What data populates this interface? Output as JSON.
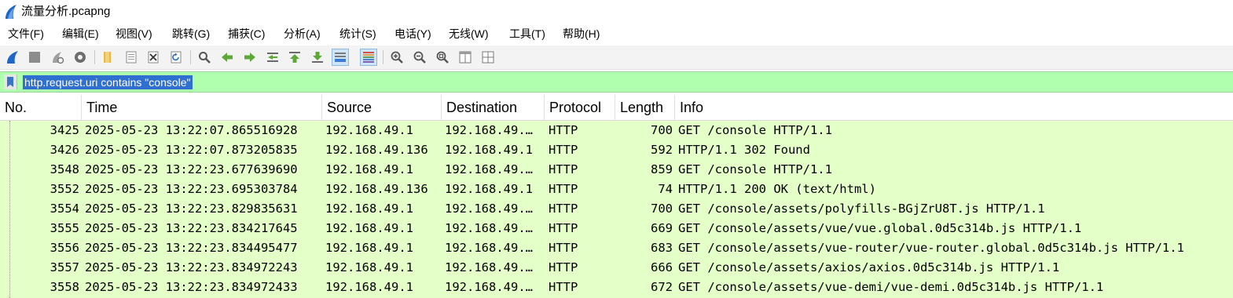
{
  "window": {
    "title": "流量分析.pcapng",
    "icon": "wireshark-fin-icon"
  },
  "menu": [
    "文件(F)",
    "编辑(E)",
    "视图(V)",
    "跳转(G)",
    "捕获(C)",
    "分析(A)",
    "统计(S)",
    "电话(Y)",
    "无线(W)",
    "工具(T)",
    "帮助(H)"
  ],
  "toolbar_icons": [
    "start-capture-icon",
    "stop-capture-icon",
    "restart-capture-icon",
    "capture-options-icon",
    "open-file-icon",
    "save-file-icon",
    "close-file-icon",
    "reload-file-icon",
    "find-packet-icon",
    "go-back-icon",
    "go-forward-icon",
    "go-to-packet-icon",
    "go-first-icon",
    "go-last-icon",
    "auto-scroll-icon",
    "colorize-icon",
    "zoom-in-icon",
    "zoom-out-icon",
    "zoom-normal-icon",
    "resize-columns-icon",
    "expand-columns-icon"
  ],
  "filter": {
    "value": "http.request.uri contains \"console\""
  },
  "columns": [
    "No.",
    "Time",
    "Source",
    "Destination",
    "Protocol",
    "Length",
    "Info"
  ],
  "packets": [
    {
      "no": "3425",
      "time": "2025-05-23 13:22:07.865516928",
      "source": "192.168.49.1",
      "destination": "192.168.49.…",
      "protocol": "HTTP",
      "length": "700",
      "info": "GET /console HTTP/1.1"
    },
    {
      "no": "3426",
      "time": "2025-05-23 13:22:07.873205835",
      "source": "192.168.49.136",
      "destination": "192.168.49.1",
      "protocol": "HTTP",
      "length": "592",
      "info": "HTTP/1.1 302 Found"
    },
    {
      "no": "3548",
      "time": "2025-05-23 13:22:23.677639690",
      "source": "192.168.49.1",
      "destination": "192.168.49.…",
      "protocol": "HTTP",
      "length": "859",
      "info": "GET /console HTTP/1.1"
    },
    {
      "no": "3552",
      "time": "2025-05-23 13:22:23.695303784",
      "source": "192.168.49.136",
      "destination": "192.168.49.1",
      "protocol": "HTTP",
      "length": "74",
      "info": "HTTP/1.1 200 OK  (text/html)"
    },
    {
      "no": "3554",
      "time": "2025-05-23 13:22:23.829835631",
      "source": "192.168.49.1",
      "destination": "192.168.49.…",
      "protocol": "HTTP",
      "length": "700",
      "info": "GET /console/assets/polyfills-BGjZrU8T.js HTTP/1.1"
    },
    {
      "no": "3555",
      "time": "2025-05-23 13:22:23.834217645",
      "source": "192.168.49.1",
      "destination": "192.168.49.…",
      "protocol": "HTTP",
      "length": "669",
      "info": "GET /console/assets/vue/vue.global.0d5c314b.js HTTP/1.1"
    },
    {
      "no": "3556",
      "time": "2025-05-23 13:22:23.834495477",
      "source": "192.168.49.1",
      "destination": "192.168.49.…",
      "protocol": "HTTP",
      "length": "683",
      "info": "GET /console/assets/vue-router/vue-router.global.0d5c314b.js HTTP/1.1"
    },
    {
      "no": "3557",
      "time": "2025-05-23 13:22:23.834972243",
      "source": "192.168.49.1",
      "destination": "192.168.49.…",
      "protocol": "HTTP",
      "length": "666",
      "info": "GET /console/assets/axios/axios.0d5c314b.js HTTP/1.1"
    },
    {
      "no": "3558",
      "time": "2025-05-23 13:22:23.834972433",
      "source": "192.168.49.1",
      "destination": "192.168.49.…",
      "protocol": "HTTP",
      "length": "672",
      "info": "GET /console/assets/vue-demi/vue-demi.0d5c314b.js HTTP/1.1"
    }
  ],
  "colors": {
    "filter_valid_bg": "#afffaf",
    "row_bg": "#e4ffc7",
    "selection": "#2f6fd0",
    "wireshark_blue": "#1f66c8"
  }
}
